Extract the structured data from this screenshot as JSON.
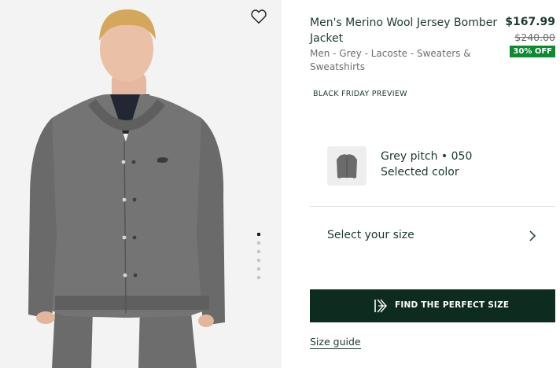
{
  "product": {
    "title": "Men's Merino Wool Jersey Bomber Jacket",
    "breadcrumb": "Men - Grey - Lacoste - Sweaters & Sweatshirts",
    "price": "$167.99",
    "original_price": "$240.00",
    "discount_badge": "30% OFF",
    "promo_label": "BLACK FRIDAY PREVIEW"
  },
  "color": {
    "name": "Grey pitch • 050",
    "caption": "Selected color",
    "swatch_icon": "jacket-thumbnail-icon"
  },
  "size": {
    "label": "Select your size",
    "icon": "chevron-right-icon"
  },
  "cta": {
    "label": "FIND THE PERFECT SIZE",
    "icon": "size-finder-logo-icon"
  },
  "size_guide": {
    "label": "Size guide"
  },
  "gallery": {
    "wishlist_icon": "heart-icon",
    "image_count": 6,
    "active_index": 0
  },
  "colors": {
    "primary_dark_green": "#0d2c1f",
    "text_green": "#1c3a2c",
    "discount_green": "#0b8a2f",
    "image_background": "#f3f3f3"
  }
}
